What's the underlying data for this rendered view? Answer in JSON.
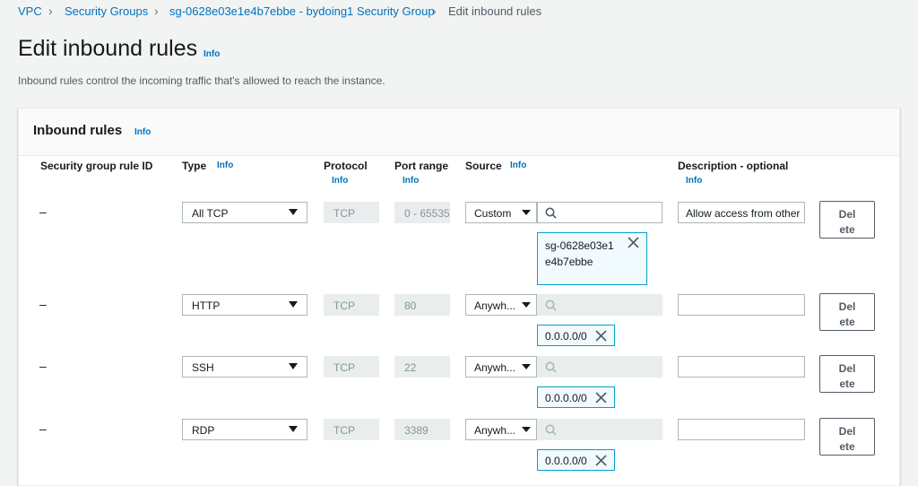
{
  "breadcrumb": {
    "vpc": "VPC",
    "security_groups": "Security Groups",
    "group": "sg-0628e03e1e4b7ebbe - bydoing1 Security Group",
    "current": "Edit inbound rules"
  },
  "page": {
    "title": "Edit inbound rules",
    "info": "Info",
    "description": "Inbound rules control the incoming traffic that's allowed to reach the instance."
  },
  "panel": {
    "title": "Inbound rules",
    "info": "Info"
  },
  "columns": {
    "rule_id": "Security group rule ID",
    "type": "Type",
    "type_info": "Info",
    "protocol": "Protocol",
    "protocol_info": "Info",
    "port_range": "Port range",
    "port_info": "Info",
    "source": "Source",
    "source_info": "Info",
    "description": "Description - optional",
    "description_info": "Info"
  },
  "rows": [
    {
      "rule_id": "–",
      "type": "All TCP",
      "protocol": "TCP",
      "port": "0 - 65535",
      "source_type": "Custom",
      "search": "",
      "token": "sg-0628e03e1e4b7ebbe",
      "description": "Allow access from other",
      "delete": "Delete"
    },
    {
      "rule_id": "–",
      "type": "HTTP",
      "protocol": "TCP",
      "port": "80",
      "source_type": "Anywh...",
      "search": "",
      "token": "0.0.0.0/0",
      "description": "",
      "delete": "Delete"
    },
    {
      "rule_id": "–",
      "type": "SSH",
      "protocol": "TCP",
      "port": "22",
      "source_type": "Anywh...",
      "search": "",
      "token": "0.0.0.0/0",
      "description": "",
      "delete": "Delete"
    },
    {
      "rule_id": "–",
      "type": "RDP",
      "protocol": "TCP",
      "port": "3389",
      "source_type": "Anywh...",
      "search": "",
      "token": "0.0.0.0/0",
      "description": "",
      "delete": "Delete"
    }
  ],
  "icons": {
    "search": "search-icon",
    "close": "close-icon",
    "caret": "caret-down-icon",
    "chevron": "chevron-right-icon"
  },
  "colors": {
    "link": "#0073bb",
    "token_border": "#00a1c9",
    "background": "#f2f3f3"
  }
}
